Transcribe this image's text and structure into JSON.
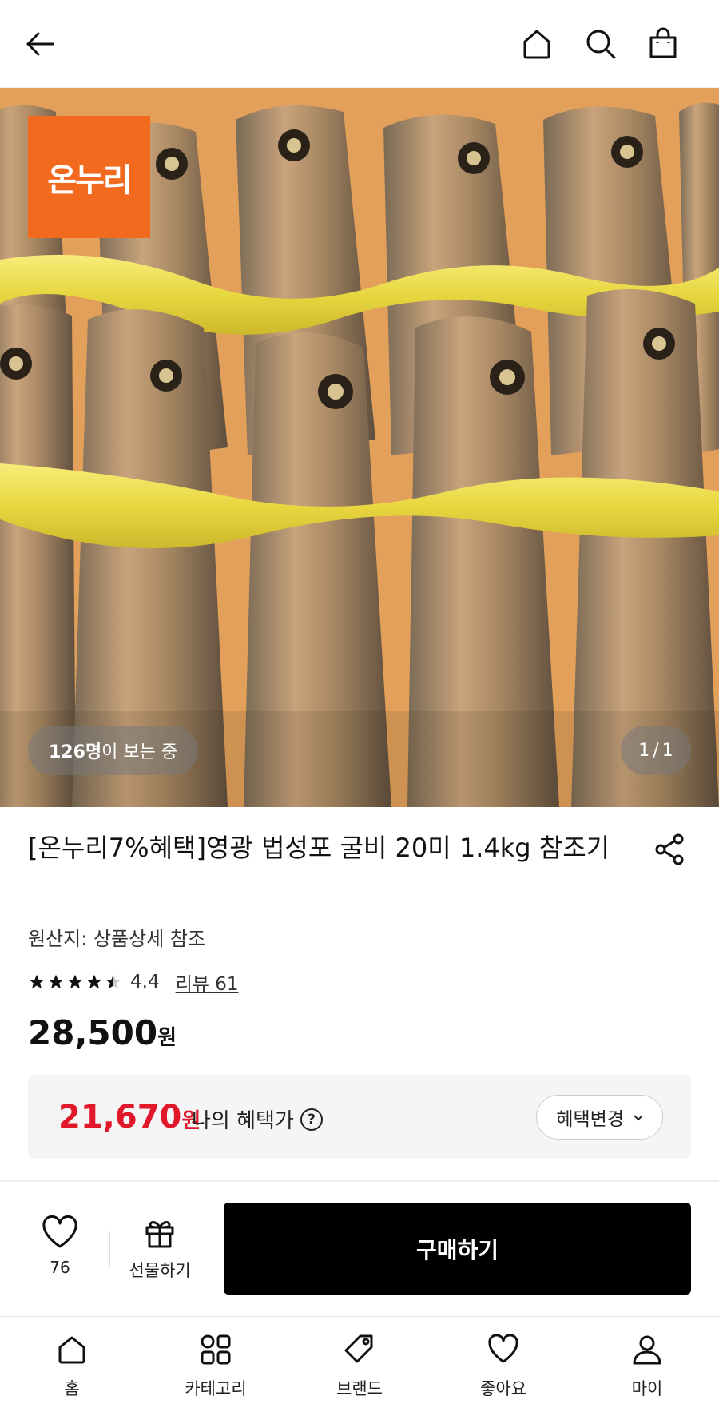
{
  "header": {
    "icons": [
      "back-arrow-icon",
      "home-icon",
      "search-icon",
      "shopping-bag-icon"
    ]
  },
  "hero": {
    "logo_text": "온누리",
    "viewers_count": "126명",
    "viewers_suffix": "이 보는 중",
    "pager_current": "1",
    "pager_sep": "/",
    "pager_total": "1"
  },
  "product": {
    "title": "[온누리7%혜택]영광 법성포 굴비 20미 1.4kg 참조기",
    "origin": "원산지: 상품상세 참조",
    "rating_value": 4.4,
    "rating_text": "4.4",
    "review_label": "리뷰 61",
    "price": "28,500",
    "price_unit": "원"
  },
  "benefit": {
    "price": "21,670",
    "price_unit": "원",
    "label": "나의 혜택가",
    "help_icon": "?",
    "change_button": "혜택변경",
    "colors": {
      "price": "#e0182a"
    }
  },
  "actions": {
    "like_count": "76",
    "gift_label": "선물하기",
    "buy_label": "구매하기"
  },
  "bottom_nav": {
    "items": [
      {
        "label": "홈",
        "icon": "home-icon"
      },
      {
        "label": "카테고리",
        "icon": "category-grid-icon"
      },
      {
        "label": "브랜드",
        "icon": "tag-icon"
      },
      {
        "label": "좋아요",
        "icon": "heart-icon"
      },
      {
        "label": "마이",
        "icon": "person-icon"
      }
    ]
  }
}
